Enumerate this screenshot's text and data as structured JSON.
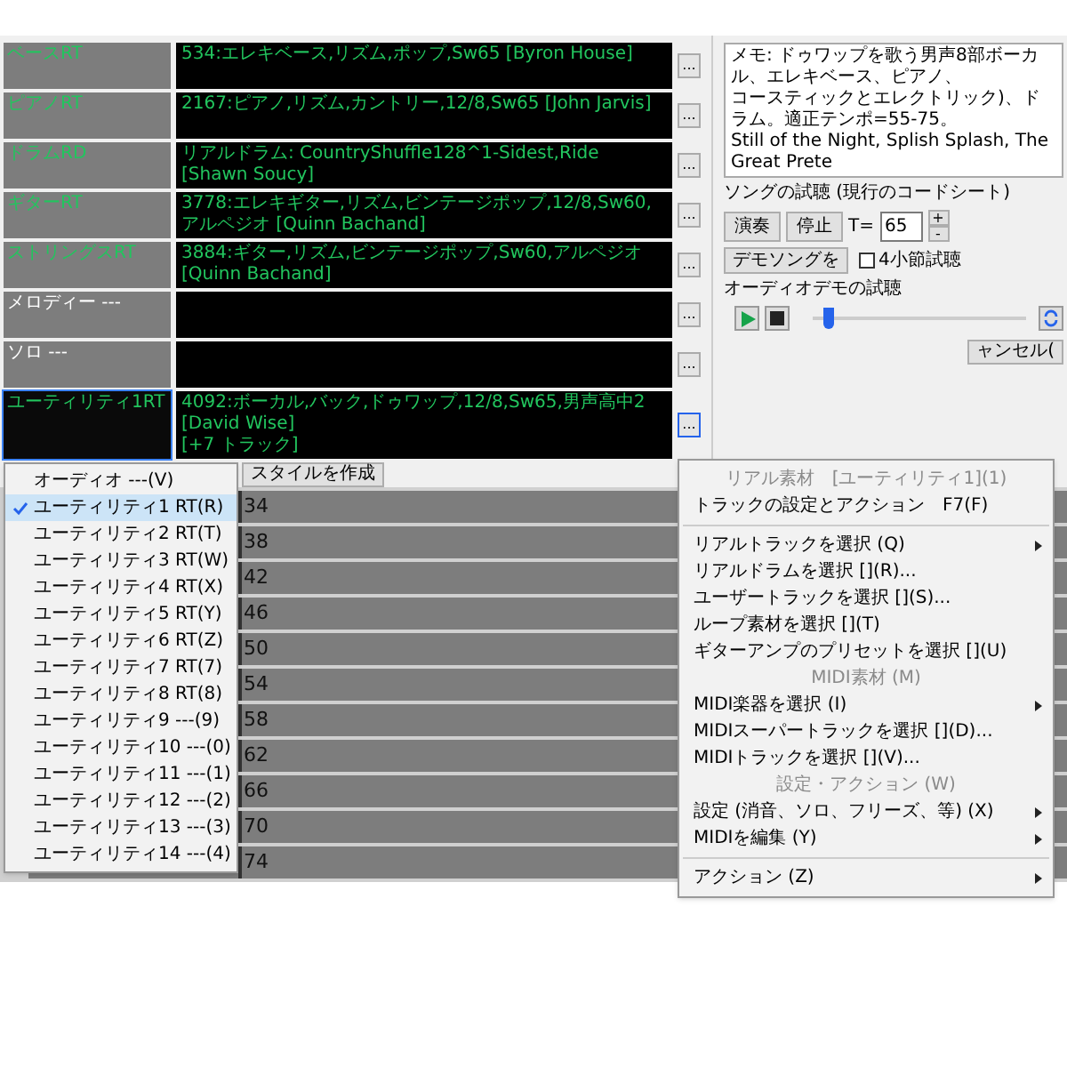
{
  "tracks": [
    {
      "label": "ベースRT",
      "kind": "rt",
      "value": "534:エレキベース,リズム,ポップ,Sw65 [Byron House]"
    },
    {
      "label": "ピアノRT",
      "kind": "rt",
      "value": "2167:ピアノ,リズム,カントリー,12/8,Sw65 [John Jarvis]"
    },
    {
      "label": "ドラムRD",
      "kind": "rt",
      "value": "リアルドラム: CountryShuffle128^1-Sidest,Ride [Shawn Soucy]"
    },
    {
      "label": "ギターRT",
      "kind": "rt",
      "value": "3778:エレキギター,リズム,ビンテージポップ,12/8,Sw60,アルペジオ [Quinn Bachand]"
    },
    {
      "label": "ストリングスRT",
      "kind": "rt",
      "value": "3884:ギター,リズム,ビンテージポップ,Sw60,アルペジオ [Quinn Bachand]"
    },
    {
      "label": "メロディー ---",
      "kind": "empty"
    },
    {
      "label": "ソロ ---",
      "kind": "empty"
    },
    {
      "label": "ユーティリティ1RT",
      "kind": "active",
      "value": "4092:ボーカル,バック,ドゥワップ,12/8,Sw65,男声高中2 [David Wise]",
      "extra": "[+7 トラック]"
    }
  ],
  "more_button": "...",
  "style_button": "スタイルを作成",
  "memo": [
    "メモ: ドゥワップを歌う男声8部ボーカル、エレキベース、ピアノ、",
    "コースティックとエレクトリック)、ドラム。適正テンポ=55-75。",
    "Still of the Night, Splish Splash, The Great Prete"
  ],
  "song_preview": {
    "title": "ソングの試聴 (現行のコードシート)",
    "play": "演奏",
    "stop": "停止",
    "tempo_label": "T=",
    "tempo": "65",
    "plus": "+",
    "minus": "-",
    "demo_button": "デモソングを",
    "four_bar": {
      "label": "4小節試聴",
      "checked": false
    }
  },
  "audio_demo": {
    "title": "オーディオデモの試聴",
    "level": 0.05
  },
  "cancel_button": "ャンセル(",
  "grid_rows": [
    "34",
    "38",
    "42",
    "46",
    "50",
    "54",
    "58",
    "62",
    "66",
    "70",
    "74"
  ],
  "track_menu": [
    {
      "label": "オーディオ ---(V)",
      "checked": false
    },
    {
      "label": "ユーティリティ1 RT(R)",
      "checked": true
    },
    {
      "label": "ユーティリティ2 RT(T)",
      "checked": false
    },
    {
      "label": "ユーティリティ3 RT(W)",
      "checked": false
    },
    {
      "label": "ユーティリティ4 RT(X)",
      "checked": false
    },
    {
      "label": "ユーティリティ5 RT(Y)",
      "checked": false
    },
    {
      "label": "ユーティリティ6 RT(Z)",
      "checked": false
    },
    {
      "label": "ユーティリティ7 RT(7)",
      "checked": false
    },
    {
      "label": "ユーティリティ8 RT(8)",
      "checked": false
    },
    {
      "label": "ユーティリティ9 ---(9)",
      "checked": false
    },
    {
      "label": "ユーティリティ10 ---(0)",
      "checked": false
    },
    {
      "label": "ユーティリティ11 ---(1)",
      "checked": false
    },
    {
      "label": "ユーティリティ12 ---(2)",
      "checked": false
    },
    {
      "label": "ユーティリティ13 ---(3)",
      "checked": false
    },
    {
      "label": "ユーティリティ14 ---(4)",
      "checked": false
    }
  ],
  "context_menu": [
    {
      "kind": "header",
      "label": "リアル素材",
      "extra": "[ユーティリティ1](1)"
    },
    {
      "kind": "item",
      "label": "トラックの設定とアクション",
      "shortcut": "F7(F)"
    },
    {
      "kind": "separator"
    },
    {
      "kind": "submenu",
      "label": "リアルトラックを選択 (Q)"
    },
    {
      "kind": "item",
      "label": "リアルドラムを選択 [](R)..."
    },
    {
      "kind": "item",
      "label": "ユーザートラックを選択 [](S)..."
    },
    {
      "kind": "item",
      "label": "ループ素材を選択 [](T)"
    },
    {
      "kind": "item",
      "label": "ギターアンプのプリセットを選択 [](U)"
    },
    {
      "kind": "header",
      "label": "MIDI素材 (M)"
    },
    {
      "kind": "submenu",
      "label": "MIDI楽器を選択 (I)"
    },
    {
      "kind": "item",
      "label": "MIDIスーパートラックを選択 [](D)..."
    },
    {
      "kind": "item",
      "label": "MIDIトラックを選択 [](V)..."
    },
    {
      "kind": "header",
      "label": "設定・アクション (W)"
    },
    {
      "kind": "submenu",
      "label": "設定 (消音、ソロ、フリーズ、等) (X)"
    },
    {
      "kind": "submenu",
      "label": "MIDIを編集 (Y)"
    },
    {
      "kind": "separator"
    },
    {
      "kind": "submenu",
      "label": "アクション (Z)"
    }
  ]
}
